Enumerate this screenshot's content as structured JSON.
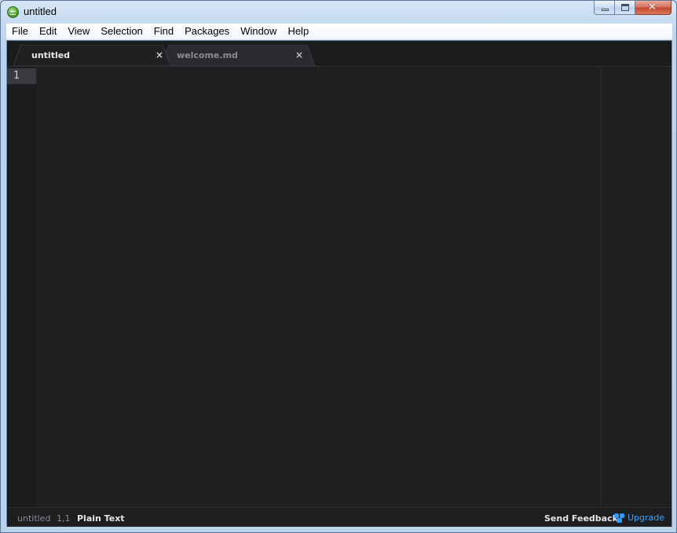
{
  "window": {
    "title": "untitled"
  },
  "menu": [
    {
      "name": "menu-file",
      "label": "File"
    },
    {
      "name": "menu-edit",
      "label": "Edit"
    },
    {
      "name": "menu-view",
      "label": "View"
    },
    {
      "name": "menu-selection",
      "label": "Selection"
    },
    {
      "name": "menu-find",
      "label": "Find"
    },
    {
      "name": "menu-packages",
      "label": "Packages"
    },
    {
      "name": "menu-window",
      "label": "Window"
    },
    {
      "name": "menu-help",
      "label": "Help"
    }
  ],
  "tabs": [
    {
      "label": "untitled",
      "close": "×",
      "active": true
    },
    {
      "label": "welcome.md",
      "close": "×",
      "active": false
    }
  ],
  "editor": {
    "line_numbers": [
      "1"
    ]
  },
  "status": {
    "file": "untitled",
    "cursor": "1,1",
    "syntax": "Plain Text",
    "feedback": "Send Feedback",
    "upgrade": "Upgrade"
  },
  "colors": {
    "editor_bg": "#1f2022",
    "accent_upgrade": "#3aa4ff"
  },
  "icons": {
    "app": "app-logo-icon",
    "minimize": "minimize-icon",
    "maximize": "maximize-icon",
    "close": "close-icon",
    "upgrade": "upgrade-icon"
  }
}
